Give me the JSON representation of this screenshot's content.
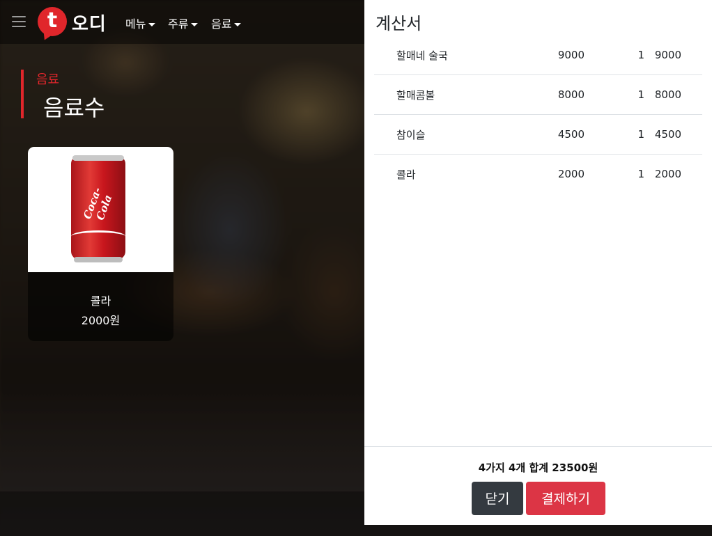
{
  "navbar": {
    "logo_letter": "t",
    "logo_text": "오디",
    "menu_items": [
      {
        "label": "메뉴"
      },
      {
        "label": "주류"
      },
      {
        "label": "음료"
      }
    ]
  },
  "section": {
    "category": "음료",
    "title": "음료수"
  },
  "product": {
    "name": "콜라",
    "price": "2000원",
    "can_logo": "Coca-Cola"
  },
  "bill": {
    "title": "계산서",
    "rows": [
      {
        "name": "할매네 술국",
        "price": "9000",
        "qty": "1",
        "total": "9000"
      },
      {
        "name": "할매콤볼",
        "price": "8000",
        "qty": "1",
        "total": "8000"
      },
      {
        "name": "참이슬",
        "price": "4500",
        "qty": "1",
        "total": "4500"
      },
      {
        "name": "콜라",
        "price": "2000",
        "qty": "1",
        "total": "2000"
      }
    ],
    "summary": "4가지 4개 합계 23500원",
    "close_label": "닫기",
    "pay_label": "결제하기"
  },
  "colors": {
    "brand_red": "#e0262b",
    "pay_button": "#dc3545",
    "close_button": "#343a40"
  }
}
